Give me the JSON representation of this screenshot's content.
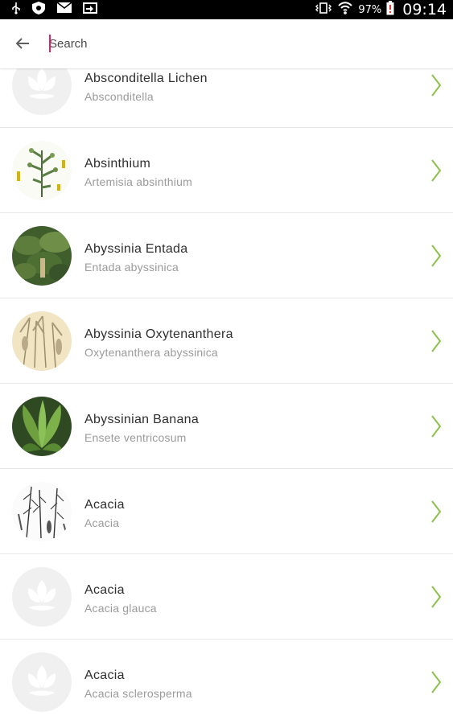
{
  "status_bar": {
    "battery_percent": "97%",
    "time": "09:14"
  },
  "search": {
    "placeholder": "Search",
    "value": ""
  },
  "plants": [
    {
      "name": "Absconditella Lichen",
      "scientific": "Absconditella",
      "thumbnail": "placeholder-icon"
    },
    {
      "name": "Absinthium",
      "scientific": "Artemisia absinthium",
      "thumbnail": "botanical-illustration"
    },
    {
      "name": "Abyssinia Entada",
      "scientific": "Entada abyssinica",
      "thumbnail": "photo-green-foliage"
    },
    {
      "name": "Abyssinia Oxytenanthera",
      "scientific": "Oxytenanthera abyssinica",
      "thumbnail": "botanical-sketch-beige"
    },
    {
      "name": "Abyssinian Banana",
      "scientific": "Ensete ventricosum",
      "thumbnail": "photo-banana-plant"
    },
    {
      "name": "Acacia",
      "scientific": "Acacia",
      "thumbnail": "botanical-ink-drawing"
    },
    {
      "name": "Acacia",
      "scientific": "Acacia glauca",
      "thumbnail": "placeholder-icon"
    },
    {
      "name": "Acacia",
      "scientific": "Acacia sclerosperma",
      "thumbnail": "placeholder-icon"
    }
  ],
  "colors": {
    "accent_green": "#8bc34a",
    "cursor_pink": "#e91e63",
    "status_bar_bg": "#000000"
  }
}
